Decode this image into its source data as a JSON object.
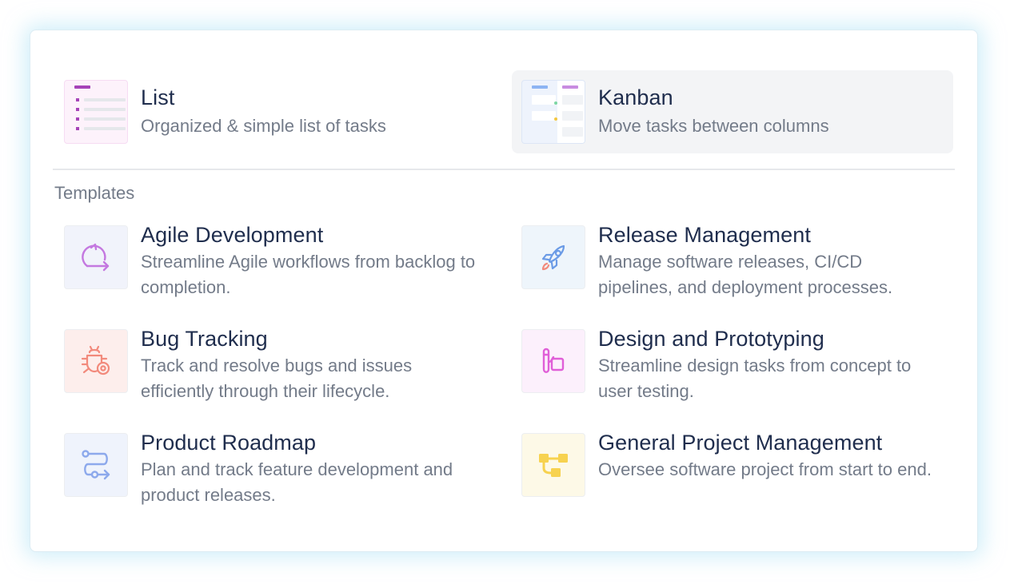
{
  "views": [
    {
      "title": "List",
      "description": "Organized & simple list of tasks",
      "selected": false
    },
    {
      "title": "Kanban",
      "description": "Move tasks between columns",
      "selected": true
    }
  ],
  "templates_label": "Templates",
  "templates": [
    {
      "title": "Agile Development",
      "description": "Streamline Agile workflows from backlog to completion.",
      "icon": "agile-loop-icon",
      "color": "#c478e0",
      "bg": "#f1f3fb"
    },
    {
      "title": "Release Management",
      "description": "Manage software releases, CI/CD pipelines, and deployment processes.",
      "icon": "rocket-icon",
      "color": "#6b9be6",
      "bg": "#eef5fb"
    },
    {
      "title": "Bug Tracking",
      "description": "Track and resolve bugs and issues efficiently through their lifecycle.",
      "icon": "bug-icon",
      "color": "#f28a7c",
      "bg": "#fdeeec"
    },
    {
      "title": "Design and Prototyping",
      "description": "Streamline design tasks from concept to user testing.",
      "icon": "design-tools-icon",
      "color": "#e05fd8",
      "bg": "#fcf0fc"
    },
    {
      "title": "Product Roadmap",
      "description": "Plan and track feature development and product releases.",
      "icon": "roadmap-icon",
      "color": "#8da9ec",
      "bg": "#eff3fc"
    },
    {
      "title": "General Project Management",
      "description": "Oversee software project from start to end.",
      "icon": "hierarchy-icon",
      "color": "#f7d24f",
      "bg": "#fdf9e7"
    }
  ]
}
